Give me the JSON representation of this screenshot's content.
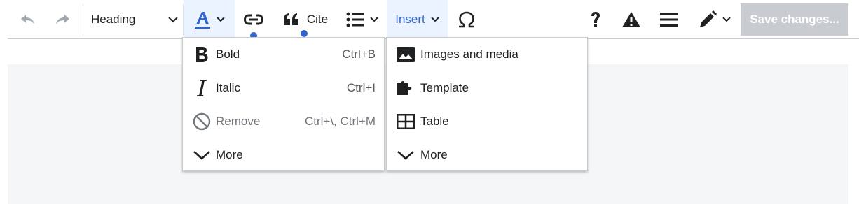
{
  "toolbar": {
    "undo_icon": "undo-icon",
    "redo_icon": "redo-icon",
    "heading_label": "Heading",
    "style_icon": "text-style-icon",
    "link_icon": "link-icon",
    "cite_label": "Cite",
    "list_icon": "bullet-list-icon",
    "insert_label": "Insert",
    "special_char_icon": "omega-icon",
    "help_icon": "help-icon",
    "notices_icon": "alert-icon",
    "page_options_icon": "menu-icon",
    "edit_mode_icon": "pencil-icon",
    "save_label": "Save changes..."
  },
  "style_menu": {
    "items": [
      {
        "label": "Bold",
        "shortcut": "Ctrl+B",
        "icon": "bold-icon"
      },
      {
        "label": "Italic",
        "shortcut": "Ctrl+I",
        "icon": "italic-icon"
      },
      {
        "label": "Remove",
        "shortcut": "Ctrl+\\, Ctrl+M",
        "icon": "remove-format-icon",
        "disabled": true
      },
      {
        "label": "More",
        "shortcut": "",
        "icon": "chevron-down-icon"
      }
    ]
  },
  "insert_menu": {
    "items": [
      {
        "label": "Images and media",
        "icon": "image-icon"
      },
      {
        "label": "Template",
        "icon": "puzzle-icon"
      },
      {
        "label": "Table",
        "icon": "table-icon"
      },
      {
        "label": "More",
        "icon": "chevron-down-icon"
      }
    ]
  },
  "colors": {
    "accent": "#3366cc",
    "active_bg": "#eaf3ff",
    "save_disabled_bg": "#c8ccd1",
    "content_bg": "#f5f6f8"
  }
}
